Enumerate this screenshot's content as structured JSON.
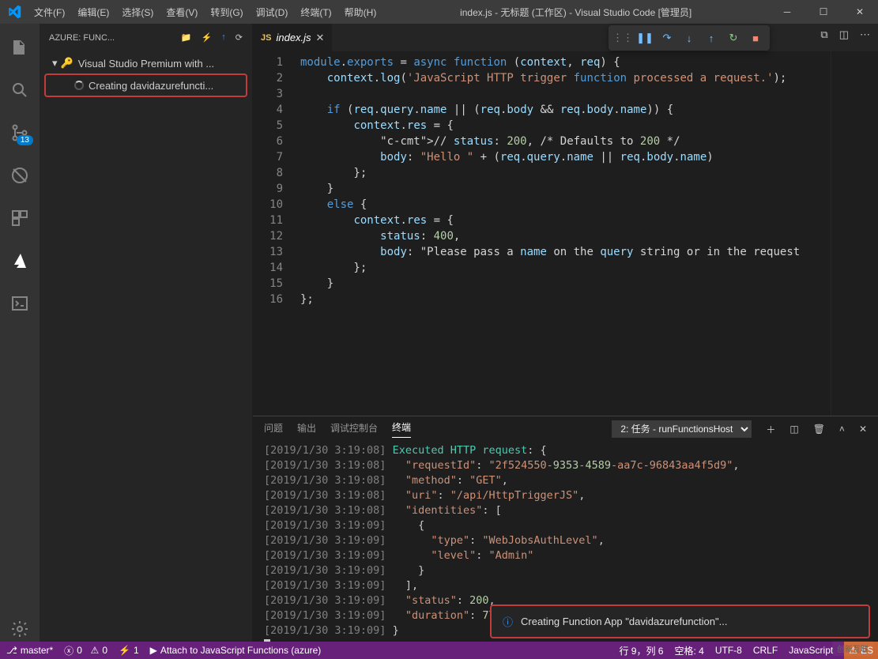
{
  "title": "index.js - 无标题 (工作区) - Visual Studio Code [管理员]",
  "menus": [
    "文件(F)",
    "编辑(E)",
    "选择(S)",
    "查看(V)",
    "转到(G)",
    "调试(D)",
    "终端(T)",
    "帮助(H)"
  ],
  "sidebar": {
    "title": "AZURE: FUNC...",
    "subscription": "Visual Studio Premium with ...",
    "creating": "Creating davidazurefuncti..."
  },
  "scm_badge": "13",
  "tab": {
    "filename": "index.js"
  },
  "code": {
    "lines": [
      "module.exports = async function (context, req) {",
      "    context.log('JavaScript HTTP trigger function processed a request.');",
      "",
      "    if (req.query.name || (req.body && req.body.name)) {",
      "        context.res = {",
      "            // status: 200, /* Defaults to 200 */",
      "            body: \"Hello \" + (req.query.name || req.body.name)",
      "        };",
      "    }",
      "    else {",
      "        context.res = {",
      "            status: 400,",
      "            body: \"Please pass a name on the query string or in the request",
      "        };",
      "    }",
      "};"
    ]
  },
  "panel": {
    "tabs": [
      "问题",
      "输出",
      "调试控制台",
      "终端"
    ],
    "active_tab": "终端",
    "selector": "2: 任务 - runFunctionsHost"
  },
  "terminal_lines": [
    {
      "ts": "[2019/1/30 3:19:08]",
      "rest": " Executed HTTP request: {"
    },
    {
      "ts": "[2019/1/30 3:19:08]",
      "rest": "   \"requestId\": \"2f524550-9353-4589-aa7c-96843aa4f5d9\","
    },
    {
      "ts": "[2019/1/30 3:19:08]",
      "rest": "   \"method\": \"GET\","
    },
    {
      "ts": "[2019/1/30 3:19:08]",
      "rest": "   \"uri\": \"/api/HttpTriggerJS\","
    },
    {
      "ts": "[2019/1/30 3:19:08]",
      "rest": "   \"identities\": ["
    },
    {
      "ts": "[2019/1/30 3:19:09]",
      "rest": "     {"
    },
    {
      "ts": "[2019/1/30 3:19:09]",
      "rest": "       \"type\": \"WebJobsAuthLevel\","
    },
    {
      "ts": "[2019/1/30 3:19:09]",
      "rest": "       \"level\": \"Admin\""
    },
    {
      "ts": "[2019/1/30 3:19:09]",
      "rest": "     }"
    },
    {
      "ts": "[2019/1/30 3:19:09]",
      "rest": "   ],"
    },
    {
      "ts": "[2019/1/30 3:19:09]",
      "rest": "   \"status\": 200,"
    },
    {
      "ts": "[2019/1/30 3:19:09]",
      "rest": "   \"duration\": 77"
    },
    {
      "ts": "[2019/1/30 3:19:09]",
      "rest": " }"
    }
  ],
  "notification": "Creating Function App \"davidazurefunction\"...",
  "statusbar": {
    "branch": "master*",
    "errors": "0",
    "warnings": "0",
    "ports": "1",
    "attach": "Attach to JavaScript Functions (azure)",
    "line": "行 9，列 6",
    "spaces": "空格: 4",
    "encoding": "UTF-8",
    "eol": "CRLF",
    "language": "JavaScript",
    "eslint": "ES"
  },
  "watermark": "创新互联"
}
